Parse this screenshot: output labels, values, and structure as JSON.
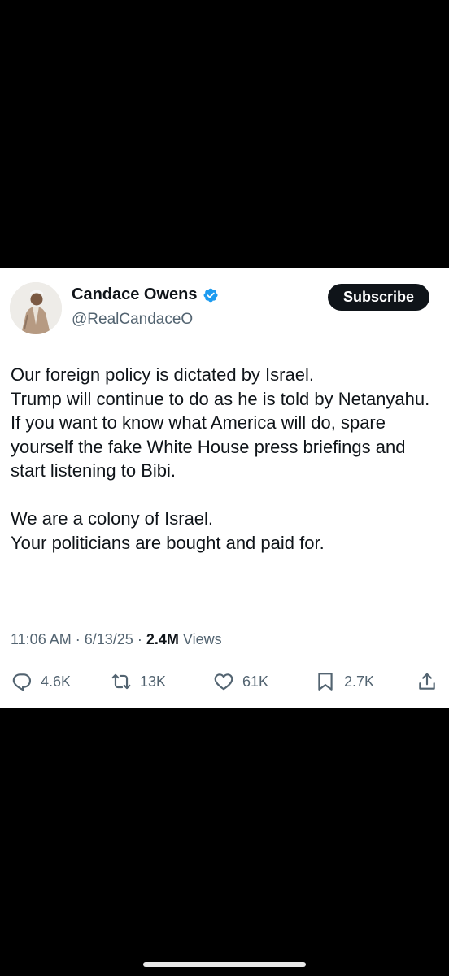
{
  "author": {
    "name": "Candace Owens",
    "handle": "@RealCandaceO",
    "verified": true,
    "verified_color": "#1d9bf0"
  },
  "subscribe_label": "Subscribe",
  "tweet": {
    "lines": [
      "Our foreign policy is dictated by Israel.",
      "Trump will continue to do as he is told by Netanyahu.",
      "If you want to know what America will do, spare yourself the fake White House press briefings and start listening to Bibi.",
      "We are a colony of Israel.",
      "Your politicians are bought and paid for."
    ]
  },
  "meta": {
    "time": "11:06 AM",
    "separator": "·",
    "date": "6/13/25",
    "views_count": "2.4M",
    "views_label": "Views"
  },
  "actions": {
    "replies": {
      "icon": "reply-icon",
      "count": "4.6K"
    },
    "reposts": {
      "icon": "repost-icon",
      "count": "13K"
    },
    "likes": {
      "icon": "heart-icon",
      "count": "61K"
    },
    "bookmarks": {
      "icon": "bookmark-icon",
      "count": "2.7K"
    },
    "share": {
      "icon": "share-icon"
    }
  },
  "colors": {
    "background": "#000000",
    "card": "#ffffff",
    "text": "#0f1419",
    "secondary": "#536471"
  }
}
